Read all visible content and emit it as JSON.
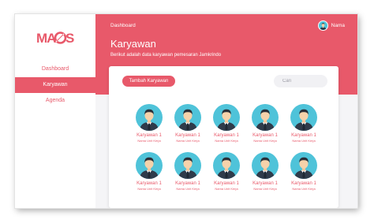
{
  "brand": {
    "logo_text": "MAGS",
    "accent": "#e8596a",
    "avatar_bg": "#4fc3d9"
  },
  "sidebar": {
    "items": [
      {
        "label": "Dashboard",
        "active": false
      },
      {
        "label": "Karyawan",
        "active": true
      },
      {
        "label": "Agenda",
        "active": false
      }
    ]
  },
  "header": {
    "breadcrumb": "Dashboard",
    "title": "Karyawan",
    "subtitle": "Berikut adalah data karyawan pemesaran Jamkrindo",
    "user_name": "Nama",
    "user_icon": "user-avatar-icon"
  },
  "toolbar": {
    "add_label": "Tambah Karyawan",
    "search_placeholder": "Cari"
  },
  "employees": [
    {
      "name": "Karyawan 1",
      "unit": "Nama Unit Kerja"
    },
    {
      "name": "Karyawan 1",
      "unit": "Nama Unit Kerja"
    },
    {
      "name": "Karyawan 1",
      "unit": "Nama Unit Kerja"
    },
    {
      "name": "Karyawan 1",
      "unit": "Nama Unit Kerja"
    },
    {
      "name": "Karyawan 1",
      "unit": "Nama Unit Kerja"
    },
    {
      "name": "Karyawan 1",
      "unit": "Nama Unit Kerja"
    },
    {
      "name": "Karyawan 1",
      "unit": "Nama Unit Kerja"
    },
    {
      "name": "Karyawan 1",
      "unit": "Nama Unit Kerja"
    },
    {
      "name": "Karyawan 1",
      "unit": "Nama Unit Kerja"
    },
    {
      "name": "Karyawan 1",
      "unit": "Nama Unit Kerja"
    }
  ]
}
